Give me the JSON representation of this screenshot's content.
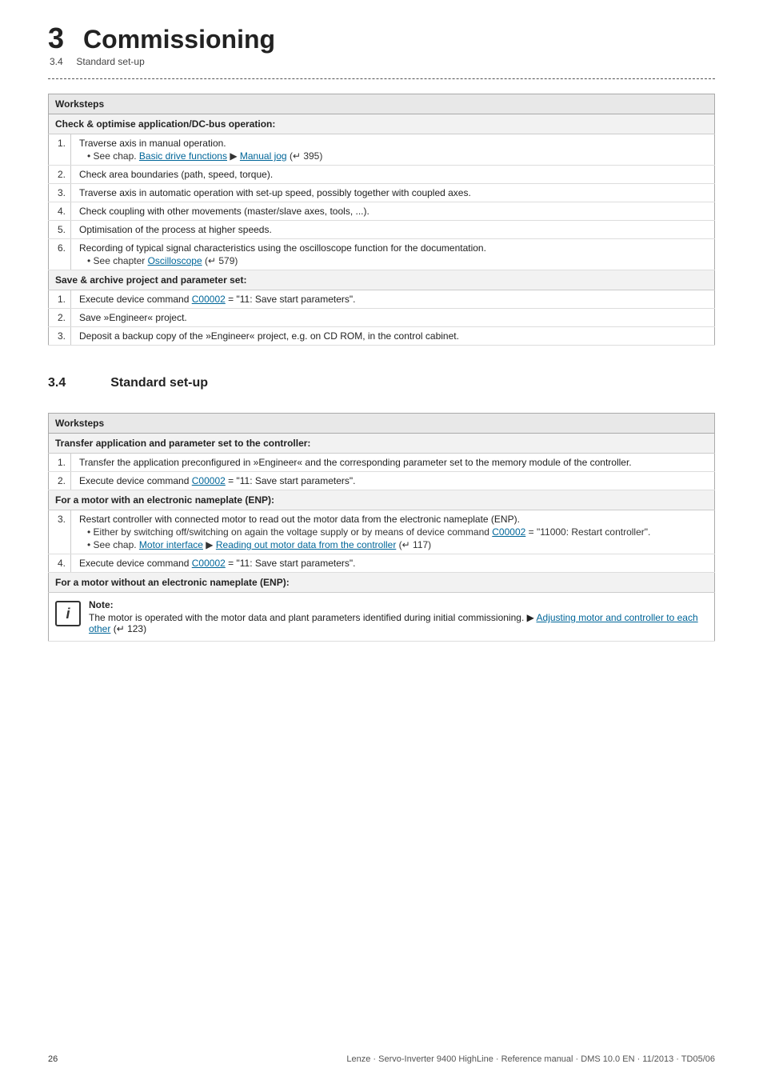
{
  "chapter": {
    "number": "3",
    "title": "Commissioning",
    "section_number": "3.4",
    "section_label": "Standard set-up"
  },
  "table1": {
    "header": "Worksteps",
    "sections": [
      {
        "id": "check",
        "label": "Check & optimise application/DC-bus operation:",
        "steps": [
          {
            "num": "1.",
            "text": "Traverse axis in manual operation.",
            "sub": [
              {
                "text_before": "• See chap. ",
                "link1_text": "Basic drive functions",
                "link1_href": "#",
                "arrow": " ▶ ",
                "link2_text": "Manual jog",
                "link2_href": "#",
                "text_after": " (↵ 395)"
              }
            ]
          },
          {
            "num": "2.",
            "text": "Check area boundaries (path, speed, torque).",
            "sub": []
          },
          {
            "num": "3.",
            "text": "Traverse axis in automatic operation with set-up speed, possibly together with coupled axes.",
            "sub": []
          },
          {
            "num": "4.",
            "text": "Check coupling with other movements (master/slave axes, tools, ...).",
            "sub": []
          },
          {
            "num": "5.",
            "text": "Optimisation of the process at higher speeds.",
            "sub": []
          },
          {
            "num": "6.",
            "text": "Recording of typical signal characteristics using the oscilloscope function for the documentation.",
            "sub": [
              {
                "text_before": "• See chapter ",
                "link1_text": "Oscilloscope",
                "link1_href": "#",
                "arrow": "",
                "link2_text": "",
                "link2_href": "",
                "text_after": " (↵ 579)"
              }
            ]
          }
        ]
      },
      {
        "id": "save",
        "label": "Save & archive project and parameter set:",
        "steps": [
          {
            "num": "1.",
            "text_before": "Execute device command ",
            "link_text": "C00002",
            "link_href": "#",
            "text_after": " = \"11: Save start parameters\".",
            "sub": []
          },
          {
            "num": "2.",
            "text": "Save »Engineer« project.",
            "sub": []
          },
          {
            "num": "3.",
            "text": "Deposit a backup copy of the »Engineer« project, e.g. on CD ROM, in the control cabinet.",
            "sub": []
          }
        ]
      }
    ]
  },
  "section34": {
    "number": "3.4",
    "title": "Standard set-up"
  },
  "table2": {
    "header": "Worksteps",
    "sections": [
      {
        "id": "transfer",
        "label": "Transfer application and parameter set to the controller:",
        "steps": [
          {
            "num": "1.",
            "text": "Transfer the application preconfigured in »Engineer« and the corresponding parameter set to the memory module of the controller.",
            "sub": []
          },
          {
            "num": "2.",
            "text_before": "Execute device command ",
            "link_text": "C00002",
            "link_href": "#",
            "text_after": " = \"11: Save start parameters\".",
            "sub": []
          }
        ]
      },
      {
        "id": "enp",
        "label": "For a motor with an electronic nameplate (ENP):",
        "steps": [
          {
            "num": "3.",
            "text": "Restart controller with connected motor to read out the motor data from the electronic nameplate (ENP).",
            "sub": [
              {
                "text_before": "• Either by switching off/switching on again the voltage supply or by means of device command ",
                "link1_text": "C00002",
                "link1_href": "#",
                "arrow": "",
                "link2_text": "",
                "link2_href": "",
                "text_after": " = \"11000: Restart controller\"."
              },
              {
                "text_before": "• See chap. ",
                "link1_text": "Motor interface",
                "link1_href": "#",
                "arrow": " ▶ ",
                "link2_text": "Reading out motor data from the controller",
                "link2_href": "#",
                "text_after": " (↵ 117)"
              }
            ]
          },
          {
            "num": "4.",
            "text_before": "Execute device command ",
            "link_text": "C00002",
            "link_href": "#",
            "text_after": " = \"11: Save start parameters\".",
            "sub": []
          }
        ]
      },
      {
        "id": "no_enp",
        "label": "For a motor without an electronic nameplate (ENP):",
        "steps": []
      }
    ],
    "note": {
      "icon": "i",
      "title": "Note:",
      "text_before": "The motor is operated with the motor data and plant parameters identified during initial commissioning. ▶ ",
      "link_text": "Adjusting motor and controller to each other",
      "link_href": "#",
      "text_after": " (↵ 123)"
    }
  },
  "footer": {
    "page_number": "26",
    "publisher": "Lenze · Servo-Inverter 9400 HighLine · Reference manual · DMS 10.0 EN · 11/2013 · TD05/06"
  }
}
